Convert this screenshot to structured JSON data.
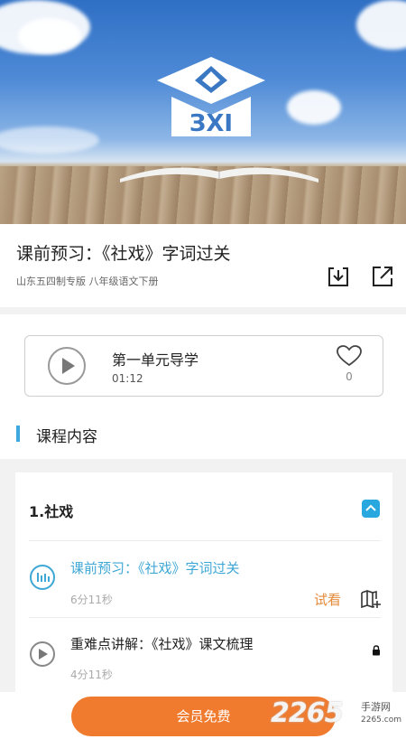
{
  "course": {
    "title": "课前预习：《社戏》字词过关",
    "subtitle": "山东五四制专版 八年级语文下册"
  },
  "audio": {
    "title": "第一单元导学",
    "time": "01:12",
    "likes": "0"
  },
  "section": {
    "title": "课程内容"
  },
  "content": {
    "chapter": "1.社戏",
    "lessons": [
      {
        "title": "课前预习：《社戏》字词过关",
        "duration": "6分11秒",
        "tag": "试看",
        "active": true
      },
      {
        "title": "重难点讲解：《社戏》课文梳理",
        "duration": "4分11秒",
        "tag": "",
        "active": false
      }
    ]
  },
  "bottom": {
    "cta_label": "会员免费"
  },
  "watermark": {
    "brand": "2265",
    "sub": "手游网",
    "url": "2265.com"
  },
  "colors": {
    "accent": "#28a8df",
    "active_text": "#3fa7d6",
    "cta": "#f07a2d",
    "trial": "#e58a3a"
  }
}
